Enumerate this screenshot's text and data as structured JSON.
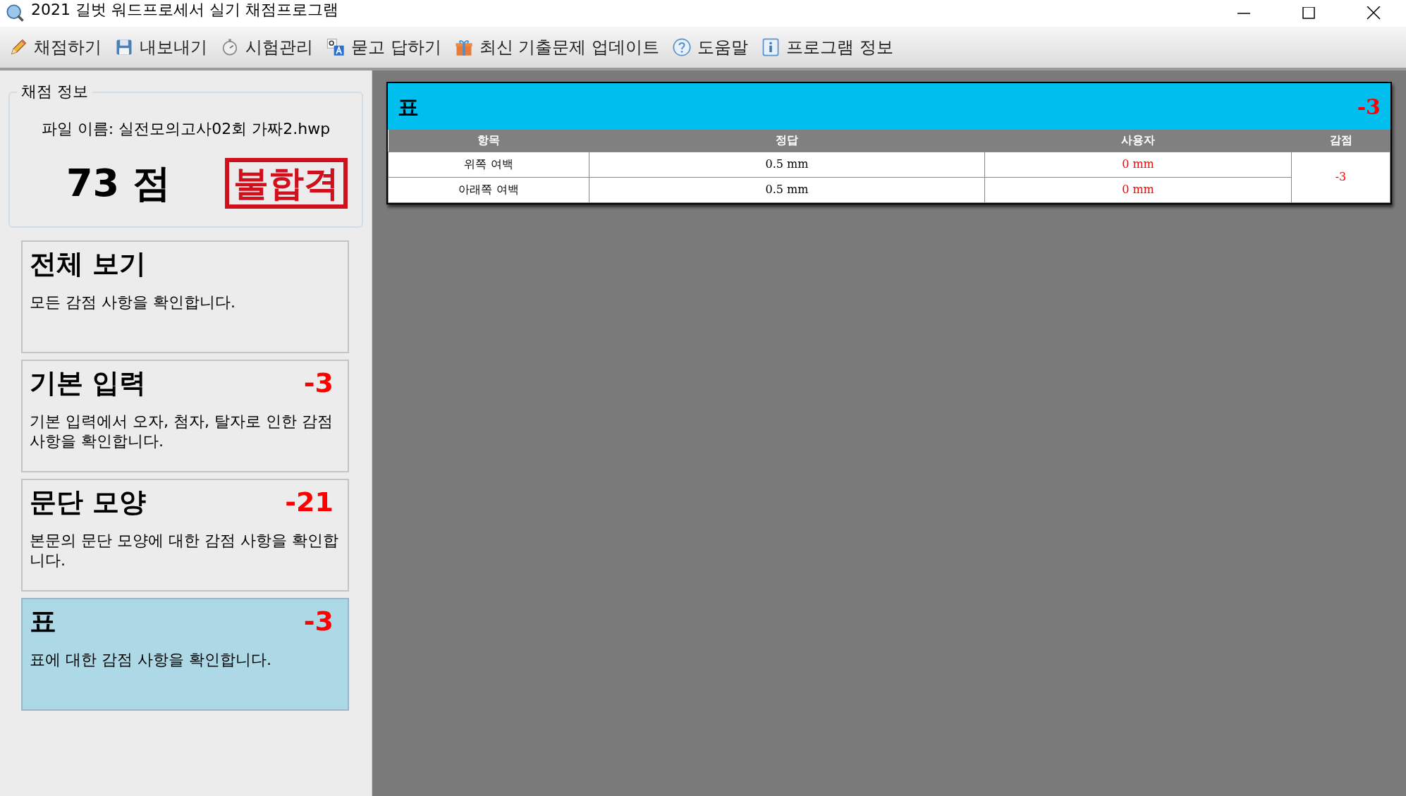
{
  "window": {
    "title": "2021 길벗 워드프로세서 실기 채점프로그램"
  },
  "toolbar": [
    {
      "kind": "pencil",
      "label": "채점하기"
    },
    {
      "kind": "disk",
      "label": "내보내기"
    },
    {
      "kind": "stopwatch",
      "label": "시험관리"
    },
    {
      "kind": "translate",
      "label": "묻고 답하기"
    },
    {
      "kind": "gift",
      "label": "최신 기출문제 업데이트"
    },
    {
      "kind": "help",
      "label": "도움말"
    },
    {
      "kind": "info",
      "label": "프로그램 정보"
    }
  ],
  "score_info": {
    "heading": "채점 정보",
    "file_name": "파일 이름: 실전모의고사02회 가짜2.hwp",
    "score": "73 점",
    "result": "불합격"
  },
  "categories": [
    {
      "title": "전체 보기",
      "description": "모든 감점 사항을 확인합니다.",
      "selected": false
    },
    {
      "title": "기본 입력",
      "deduction": "-3",
      "description": "기본 입력에서 오자, 첨자, 탈자로 인한 감점 사항을 확인합니다.",
      "selected": false
    },
    {
      "title": "문단 모양",
      "deduction": "-21",
      "description": "본문의 문단 모양에 대한 감점 사항을 확인합니다.",
      "selected": false
    },
    {
      "title": "표",
      "deduction": "-3",
      "description": "표에 대한 감점 사항을 확인합니다.",
      "selected": true
    }
  ],
  "detail": {
    "title": "표",
    "deduction": "-3",
    "columns": [
      "항목",
      "정답",
      "사용자",
      "감점"
    ],
    "rows": [
      {
        "item": "위쪽 여백",
        "answer": "0.5 mm",
        "user": "0 mm"
      },
      {
        "item": "아래쪽 여백",
        "answer": "0.5 mm",
        "user": "0 mm"
      }
    ],
    "table_deduction": "-3"
  }
}
